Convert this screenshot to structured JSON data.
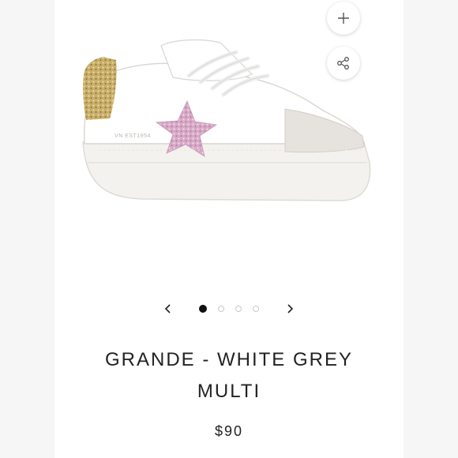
{
  "product": {
    "model_stamp": "VN EST1954",
    "title_line1": "GRANDE - WHITE GREY",
    "title_line2": "MULTI",
    "price": "$90"
  },
  "gallery": {
    "current_image": 1,
    "total_images": 4
  },
  "icons": {
    "zoom": "plus-icon",
    "share": "share-icon",
    "prev": "chevron-left-icon",
    "next": "chevron-right-icon"
  },
  "colors": {
    "active_dot": "#111111",
    "inactive_dot": "#c9c9c9",
    "glitter_star": "#d9a9c6",
    "glitter_heel": "#c8ae6a",
    "suede": "#e6e2dd"
  }
}
